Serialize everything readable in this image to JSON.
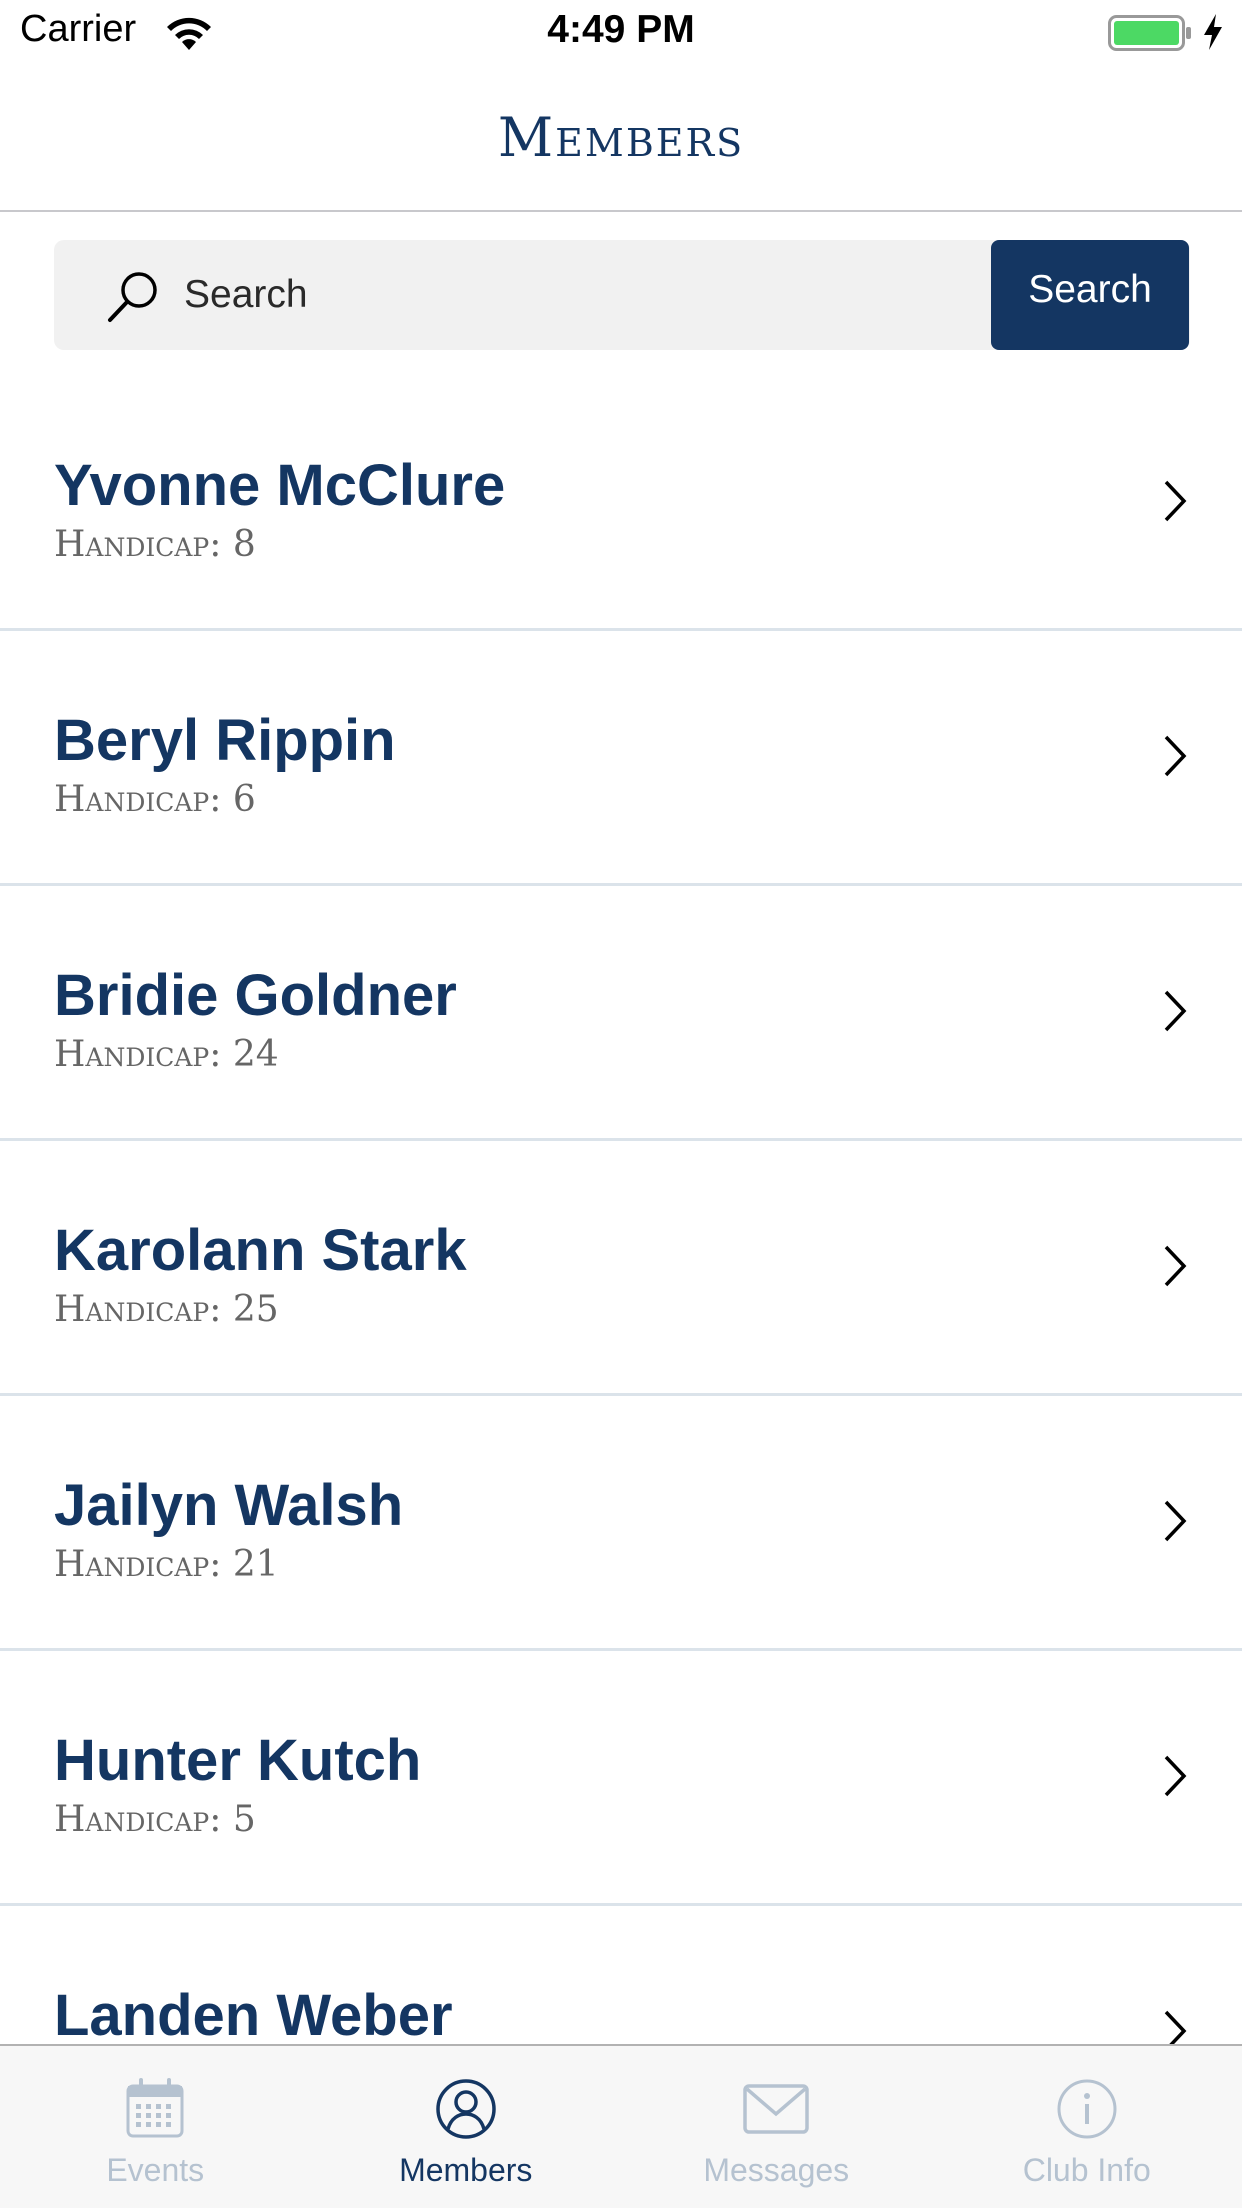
{
  "status_bar": {
    "carrier": "Carrier",
    "time": "4:49 PM",
    "battery_color": "#4cd964"
  },
  "nav": {
    "title": "Members"
  },
  "search": {
    "placeholder": "Search",
    "button_label": "Search"
  },
  "members": [
    {
      "name": "Yvonne McClure",
      "handicap": "Handicap: 8"
    },
    {
      "name": "Beryl Rippin",
      "handicap": "Handicap: 6"
    },
    {
      "name": "Bridie Goldner",
      "handicap": "Handicap: 24"
    },
    {
      "name": "Karolann Stark",
      "handicap": "Handicap: 25"
    },
    {
      "name": "Jailyn Walsh",
      "handicap": "Handicap: 21"
    },
    {
      "name": "Hunter Kutch",
      "handicap": "Handicap: 5"
    },
    {
      "name": "Landen Weber",
      "handicap": ""
    }
  ],
  "tabs": [
    {
      "label": "Events",
      "icon": "calendar-icon",
      "active": false
    },
    {
      "label": "Members",
      "icon": "person-circle-icon",
      "active": true
    },
    {
      "label": "Messages",
      "icon": "envelope-icon",
      "active": false
    },
    {
      "label": "Club Info",
      "icon": "info-circle-icon",
      "active": false
    }
  ],
  "colors": {
    "accent": "#143662",
    "inactive_tab": "#b5c2d0",
    "divider": "#dbe3ea"
  }
}
